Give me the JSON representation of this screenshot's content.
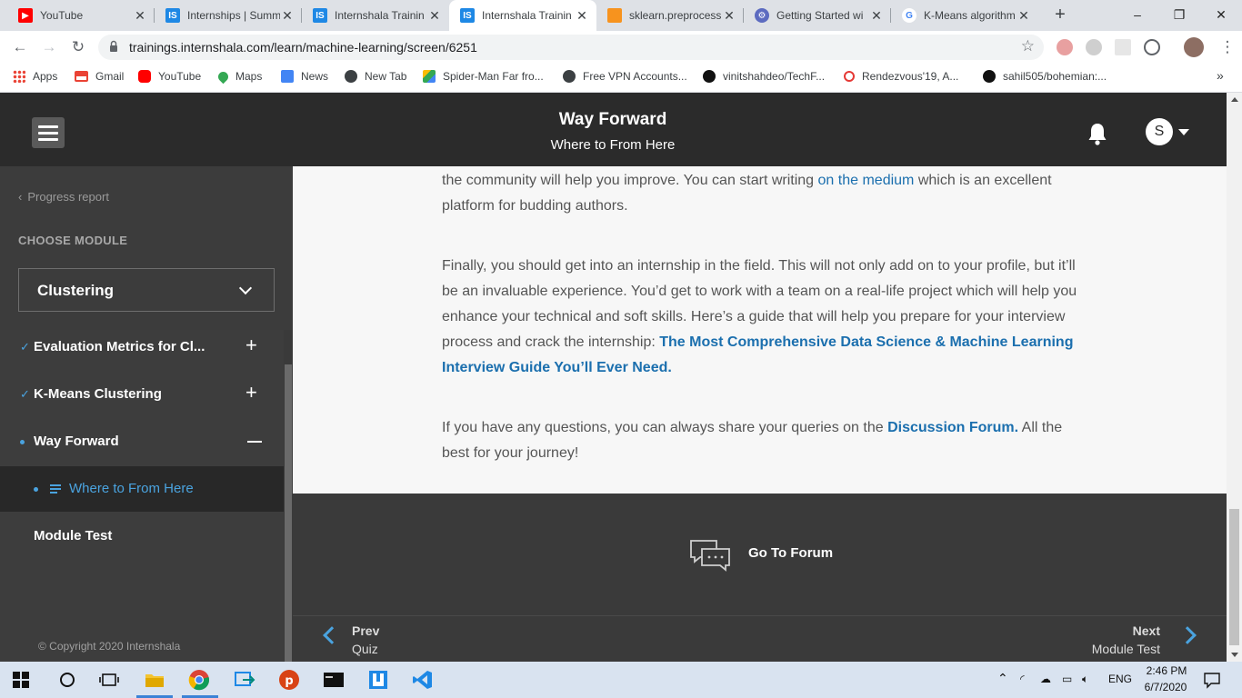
{
  "browser": {
    "tabs": [
      {
        "title": "YouTube",
        "icon": "youtube-icon",
        "color": "#ff0000"
      },
      {
        "title": "Internships | Summ",
        "icon": "internshala-icon",
        "color": "#1e88e5"
      },
      {
        "title": "Internshala Trainin",
        "icon": "internshala-icon",
        "color": "#1e88e5"
      },
      {
        "title": "Internshala Trainin",
        "icon": "internshala-icon",
        "color": "#1e88e5",
        "active": true
      },
      {
        "title": "sklearn.preprocess",
        "icon": "scikit-icon",
        "color": "#f7931e"
      },
      {
        "title": "Getting Started wi",
        "icon": "gear-globe-icon",
        "color": "#5c6bc0"
      },
      {
        "title": "K-Means algorithm",
        "icon": "google-icon",
        "color": "#4285f4"
      }
    ],
    "new_tab": "+",
    "window_controls": [
      "–",
      "❐",
      "✕"
    ],
    "url": "trainings.internshala.com/learn/machine-learning/screen/6251",
    "bookmarks": [
      {
        "label": "Apps",
        "icon": "apps-grid-icon"
      },
      {
        "label": "Gmail",
        "icon": "gmail-icon"
      },
      {
        "label": "YouTube",
        "icon": "youtube-icon"
      },
      {
        "label": "Maps",
        "icon": "maps-icon"
      },
      {
        "label": "News",
        "icon": "news-icon"
      },
      {
        "label": "New Tab",
        "icon": "globe-icon"
      },
      {
        "label": "Spider-Man Far fro...",
        "icon": "drive-icon"
      },
      {
        "label": "Free VPN Accounts...",
        "icon": "globe-icon"
      },
      {
        "label": "vinitshahdeo/TechF...",
        "icon": "github-icon"
      },
      {
        "label": "Rendezvous'19, A...",
        "icon": "rendezvous-icon"
      },
      {
        "label": "sahil505/bohemian:...",
        "icon": "github-icon"
      }
    ],
    "bookmarks_overflow": "»"
  },
  "header": {
    "title": "Way Forward",
    "subtitle": "Where to From Here",
    "avatar_initial": "S"
  },
  "sidebar": {
    "progress_link": "Progress report",
    "choose_module_label": "CHOOSE MODULE",
    "selected_module": "Clustering",
    "items": [
      {
        "label": "Evaluation Metrics for Cl...",
        "status": "completed",
        "toggle": "+"
      },
      {
        "label": "K-Means Clustering",
        "status": "completed",
        "toggle": "+"
      },
      {
        "label": "Way Forward",
        "status": "current",
        "toggle": "–"
      },
      {
        "label": "Where to From Here",
        "status": "active-sub"
      },
      {
        "label": "Module Test",
        "status": "none"
      }
    ],
    "copyright": "© Copyright 2020 Internshala"
  },
  "content": {
    "p1_text": "the community will help you improve. You can start writing ",
    "p1_link": "on the medium",
    "p1_tail": " which is an excellent platform for budding authors.",
    "p2_text": "Finally, you should get into an internship in the field. This will not only add on to your profile, but it’ll be an invaluable experience. You’d get to work with a team on a real-life project which will help you enhance your technical and soft skills. Here’s a guide that will help you prepare for your interview process and crack the internship: ",
    "p2_link": "The Most Comprehensive Data Science & Machine Learning Interview Guide You’ll Ever Need.",
    "p3_text": "If you have any questions, you can always share your queries on the ",
    "p3_link": "Discussion Forum.",
    "p3_tail": " All the best for your journey!"
  },
  "forum": {
    "label": "Go To Forum"
  },
  "nav": {
    "prev_label": "Prev",
    "prev_target": "Quiz",
    "next_label": "Next",
    "next_target": "Module Test"
  },
  "taskbar": {
    "language": "ENG",
    "time": "2:46 PM",
    "date": "6/7/2020"
  },
  "colors": {
    "accent": "#4aa3df",
    "link": "#1b6fae",
    "header_bg": "#2b2b2b",
    "sidebar_bg": "#3c3c3c"
  }
}
